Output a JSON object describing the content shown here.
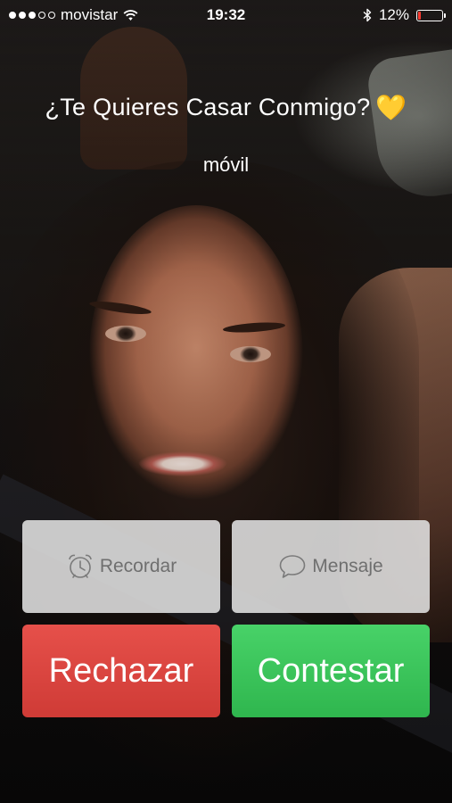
{
  "status_bar": {
    "carrier": "movistar",
    "signal_dots_total": 5,
    "signal_dots_filled": 3,
    "time": "19:32",
    "battery_percent": "12%",
    "battery_level": 0.12,
    "icons": [
      "signal-dots-icon",
      "wifi-icon",
      "bluetooth-icon",
      "battery-icon"
    ]
  },
  "caller": {
    "name": "¿Te Quieres Casar Conmigo?",
    "emoji": "💛",
    "label": "móvil"
  },
  "actions": {
    "remind_label": "Recordar",
    "remind_icon": "alarm-clock-icon",
    "message_label": "Mensaje",
    "message_icon": "speech-bubble-icon",
    "decline_label": "Rechazar",
    "answer_label": "Contestar"
  },
  "colors": {
    "decline": "#d9433e",
    "answer": "#3cc55b",
    "secondary_bg": "#e1e1e1",
    "heart": "#f4c430",
    "battery_low": "#ff3b30"
  }
}
